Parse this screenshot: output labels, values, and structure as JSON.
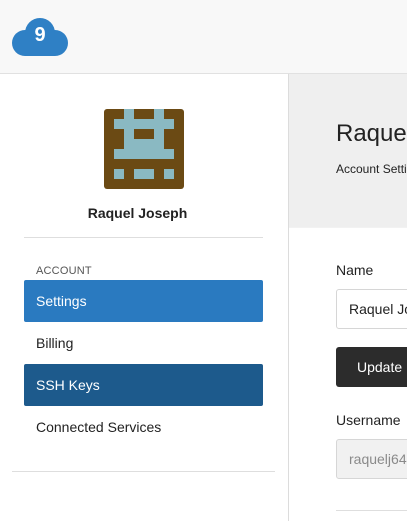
{
  "profile": {
    "name": "Raquel Joseph"
  },
  "sidebar": {
    "section_label": "ACCOUNT",
    "items": [
      {
        "label": "Settings"
      },
      {
        "label": "Billing"
      },
      {
        "label": "SSH Keys"
      },
      {
        "label": "Connected Services"
      }
    ]
  },
  "main": {
    "title": "Raquel Joseph",
    "subtitle": "Account Settings",
    "name_label": "Name",
    "name_value": "Raquel Joseph",
    "update_button": "Update",
    "username_label": "Username",
    "username_value": "raquelj64"
  },
  "colors": {
    "active_nav": "#2a7ac0",
    "ssh_nav": "#1d5a8c",
    "logo_blue": "#2f80c5",
    "button_dark": "#2c2c2c"
  },
  "icons": {
    "logo": "cloud9-logo-icon",
    "avatar": "pixel-identicon"
  }
}
